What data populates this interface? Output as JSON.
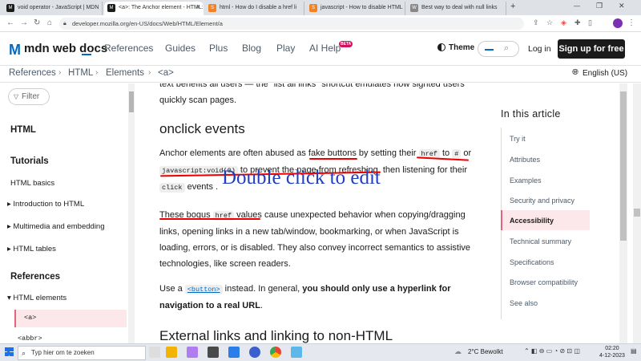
{
  "browser": {
    "tabs": [
      {
        "title": "void operator - JavaScript | MDN",
        "favicon": "M"
      },
      {
        "title": "<a>: The Anchor element - HTML:",
        "favicon": "M"
      },
      {
        "title": "html - How do I disable a href li",
        "favicon": "S"
      },
      {
        "title": "javascript - How to disable HTML",
        "favicon": "S"
      },
      {
        "title": "Best way to deal with null links",
        "favicon": "W"
      }
    ],
    "new_tab": "+",
    "url": "developer.mozilla.org/en-US/docs/Web/HTML/Element/a"
  },
  "header": {
    "logo_mark": "M",
    "logo_text": "mdn web docs",
    "nav": [
      "References",
      "Guides",
      "Plus",
      "Blog",
      "Play",
      "AI Help"
    ],
    "ai_badge": "BETA",
    "theme": "Theme",
    "login": "Log in",
    "signup": "Sign up for free"
  },
  "breadcrumb": {
    "items": [
      "References",
      "HTML",
      "Elements",
      "<a>"
    ],
    "language": "English (US)"
  },
  "sidebar": {
    "filter": "Filter",
    "heading_html": "HTML",
    "heading_tutorials": "Tutorials",
    "basics": "HTML basics",
    "intro": "Introduction to HTML",
    "multimedia": "Multimedia and embedding",
    "tables": "HTML tables",
    "heading_refs": "References",
    "elements": "HTML elements",
    "selected": "<a>",
    "next": "<abbr>"
  },
  "content": {
    "top_partial": "text benefits all users — the \"list all links\" shortcut emulates how sighted users",
    "top_line2": "quickly scan pages.",
    "heading": "onclick events",
    "p1_a": "Anchor elements are often abused as ",
    "p1_fake": "fake buttons",
    "p1_b": " by setting their ",
    "p1_href": "href",
    "p1_to": " to ",
    "p1_hash": "#",
    "p1_or": " or",
    "p1_jsvoid": "javascript:void(0)",
    "p1_c": " to prevent the page from refreshing, then listening for their",
    "p1_click": "click",
    "p1_d": " events .",
    "p2_a": "These bogus ",
    "p2_href": "href",
    "p2_b": " values",
    "p2_c": " cause unexpected behavior when copying/dragging",
    "p2_line2": "links, opening links in a new tab/window, bookmarking, or when JavaScript is",
    "p2_line3": "loading, errors, or is disabled. They also convey incorrect semantics to assistive",
    "p2_line4": "technologies, like screen readers.",
    "p3_a": "Use a ",
    "p3_button": "<button>",
    "p3_b": " instead. In general, ",
    "p3_bold1": "you should only use a hyperlink for",
    "p3_bold2": "navigation to a real URL",
    "p3_end": ".",
    "next_heading": "External links and linking to non-HTML",
    "overlay": "Double click to edit"
  },
  "toc": {
    "heading": "In this article",
    "items": [
      "Try it",
      "Attributes",
      "Examples",
      "Security and privacy",
      "Accessibility",
      "Technical summary",
      "Specifications",
      "Browser compatibility",
      "See also"
    ]
  },
  "taskbar": {
    "search": "Typ hier om te zoeken",
    "weather": "2°C  Bewolkt",
    "time": "02:20",
    "date": "4-12-2023"
  }
}
